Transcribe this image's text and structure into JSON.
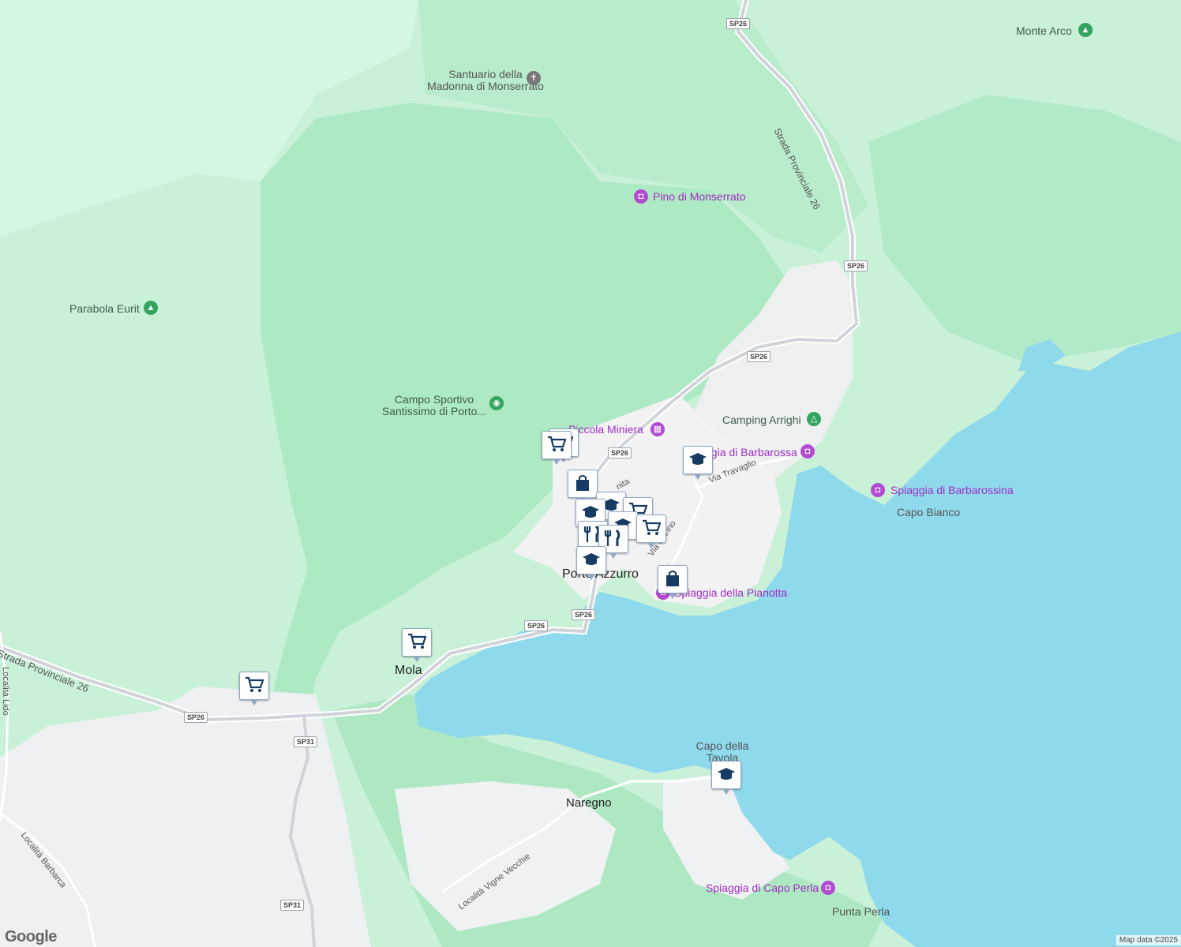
{
  "colors": {
    "sea": "#8fd9ec",
    "land": "#c9f1d8",
    "forest": "#a9e8c0",
    "urban": "#f2f2f3",
    "road": "#d0d3d8",
    "poi": "#a02fc4",
    "marker_icon": "#173c64"
  },
  "labels": {
    "santuario_line1": "Santuario della",
    "santuario_line2": "Madonna di Monserrato",
    "monte_arco": "Monte Arco",
    "pino": "Pino di Monserrato",
    "parabola": "Parabola Eurit",
    "campo_line1": "Campo Sportivo",
    "campo_line2": "Santissimo di Porto...",
    "piccola_miniera": "Piccola Miniera",
    "camping": "Camping Arrighi",
    "barbarossa": "Spiaggia di Barbarossa",
    "barbarossina": "Spiaggia di Barbarossina",
    "capo_bianco": "Capo Bianco",
    "porto_azzurro": "Porto Azzurro",
    "pianotta": "Spiaggia della Pianotta",
    "mola": "Mola",
    "capo_tavola_line1": "Capo della",
    "capo_tavola_line2": "Tavola",
    "naregno": "Naregno",
    "capo_perla_beach": "Spiaggia di Capo Perla",
    "punta_perla": "Punta Perla",
    "strada_prov_vert": "Strada Provinciale 26",
    "strada_prov_west": "Strada Provinciale 26",
    "via_travaglio": "Via Travaglio",
    "via_marino": "Via Marino",
    "via_fragment": "nita",
    "localita_lido": "Località Lido",
    "localita_barbarca": "Località Barbarca",
    "vigne_vecchie": "Località Vigne Vecchie"
  },
  "road_shields": [
    "SP26",
    "SP26",
    "SP26",
    "SP26",
    "SP26",
    "SP26",
    "SP26",
    "SP31",
    "SP31"
  ],
  "markers": [
    {
      "type": "shopping-cart"
    },
    {
      "type": "shopping-cart"
    },
    {
      "type": "shopping-bag"
    },
    {
      "type": "school"
    },
    {
      "type": "school"
    },
    {
      "type": "shopping-cart"
    },
    {
      "type": "school"
    },
    {
      "type": "restaurant"
    },
    {
      "type": "restaurant"
    },
    {
      "type": "shopping-cart"
    },
    {
      "type": "school"
    },
    {
      "type": "shopping-bag"
    },
    {
      "type": "shopping-cart"
    },
    {
      "type": "shopping-cart"
    },
    {
      "type": "school"
    }
  ],
  "google_logo": "Google",
  "attribution": "Map data ©2025"
}
